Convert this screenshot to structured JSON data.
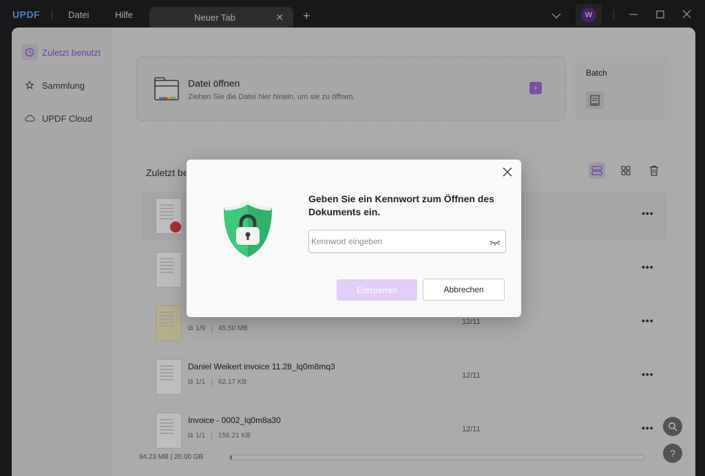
{
  "titlebar": {
    "logo": "UPDF",
    "menu": [
      "Datei",
      "Hilfe"
    ],
    "tab_label": "Neuer Tab",
    "avatar_initial": "W"
  },
  "sidebar": {
    "items": [
      {
        "label": "Zuletzt benutzt",
        "icon": "clock-icon",
        "active": true
      },
      {
        "label": "Sammlung",
        "icon": "star-icon",
        "active": false
      },
      {
        "label": "UPDF Cloud",
        "icon": "cloud-icon",
        "active": false
      }
    ]
  },
  "main": {
    "open_card": {
      "title": "Datei öffnen",
      "subtitle": "Ziehen Sie die Datei hier hinein, um sie zu öffnen."
    },
    "batch_label": "Batch",
    "recent_title": "Zuletzt be",
    "files": [
      {
        "name": "",
        "pages": "",
        "size": "",
        "date": "",
        "locked": true
      },
      {
        "name": "",
        "pages": "",
        "size": "",
        "date": "",
        "locked": false
      },
      {
        "name": "",
        "pages": "1/9",
        "size": "45.50 MB",
        "date": "12/11",
        "locked": false
      },
      {
        "name": "Daniel Weikert invoice 11.28_lq0m8mq3",
        "pages": "1/1",
        "size": "62.17 KB",
        "date": "12/11",
        "locked": false
      },
      {
        "name": "Invoice - 0002_lq0m8a30",
        "pages": "1/1",
        "size": "156.21 KB",
        "date": "12/11",
        "locked": false
      }
    ],
    "storage_text": "94.23 MB | 20.00 GB",
    "storage_fraction": 0.005
  },
  "modal": {
    "title": "Geben Sie ein Kennwort zum Öffnen des Dokuments ein.",
    "password_placeholder": "Kennwort eingeben",
    "password_value": "",
    "unlock_label": "Entsperren",
    "cancel_label": "Abbrechen"
  },
  "colors": {
    "accent": "#8e57d6",
    "unlock_disabled": "#e2cdfb",
    "shield": "#2fb36b"
  }
}
